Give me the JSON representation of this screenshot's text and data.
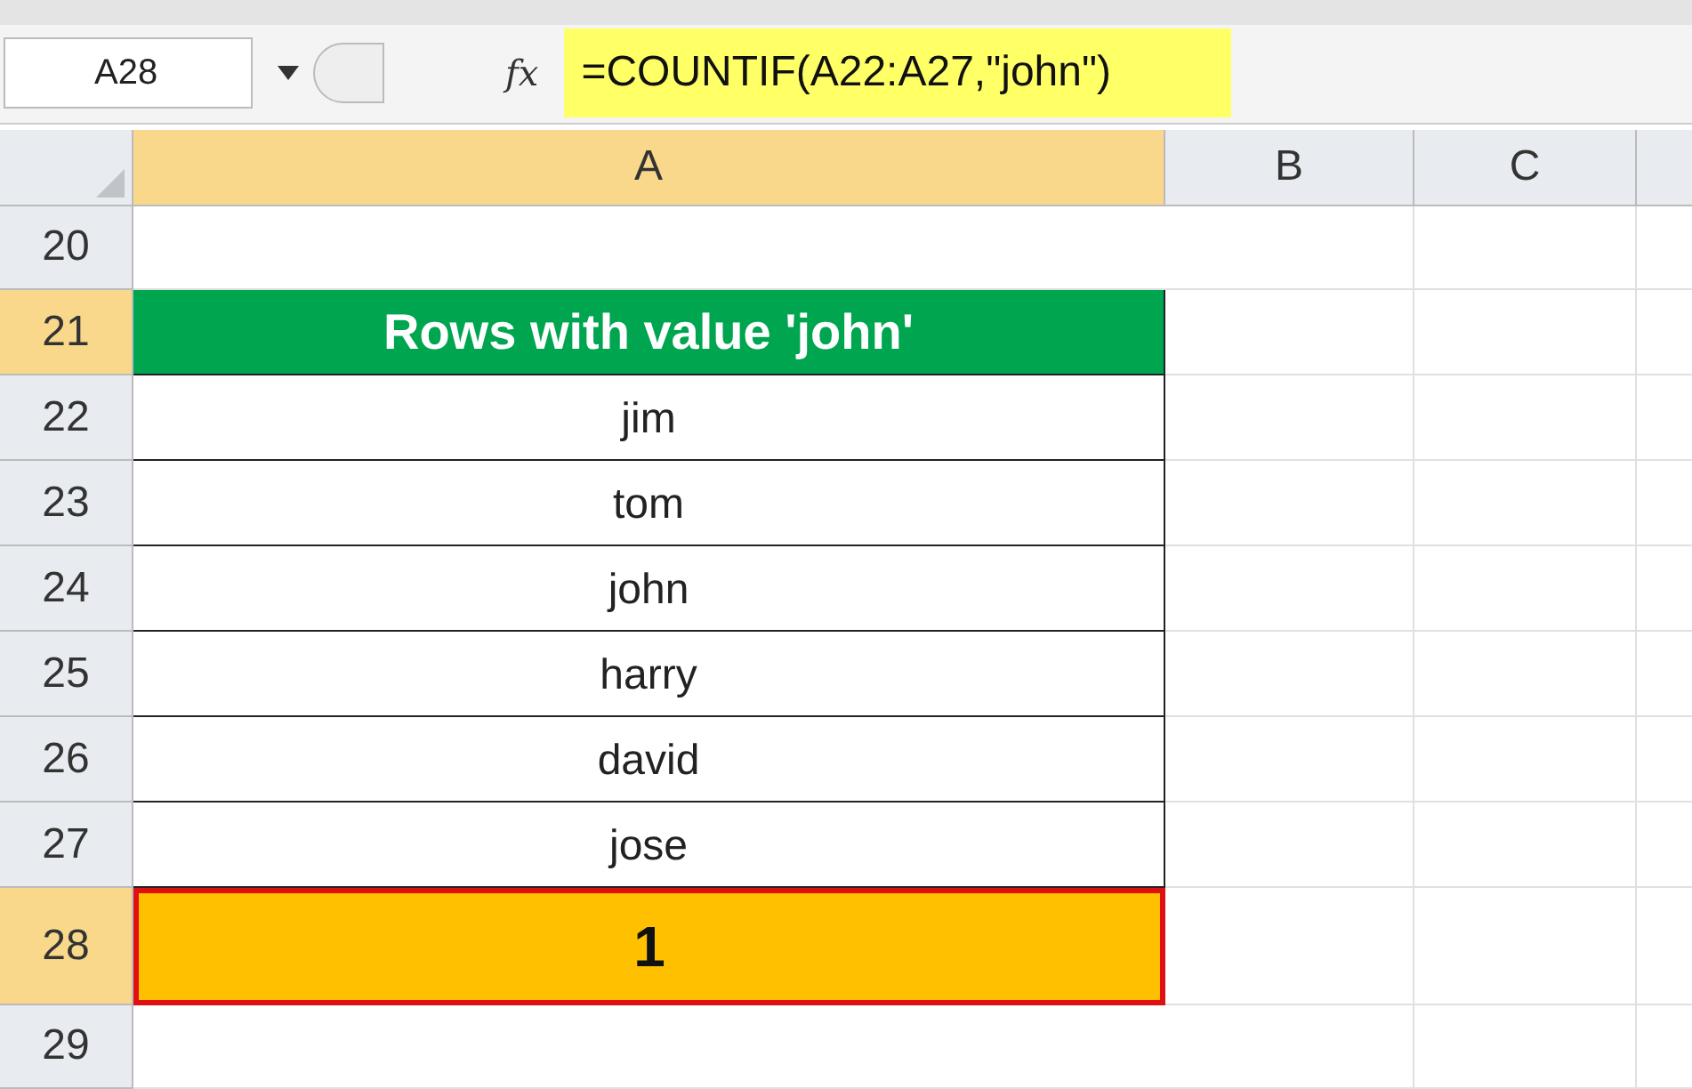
{
  "formula_bar": {
    "name_box": "A28",
    "function_label": "fx",
    "formula": "=COUNTIF(A22:A27,\"john\")",
    "highlighted": true
  },
  "columns": [
    {
      "label": "A",
      "selected": true
    },
    {
      "label": "B",
      "selected": false
    },
    {
      "label": "C",
      "selected": false
    }
  ],
  "rows": [
    {
      "number": "20",
      "selected": false,
      "kind": "blank"
    },
    {
      "number": "21",
      "selected": true,
      "kind": "title",
      "value": "Rows with value 'john'"
    },
    {
      "number": "22",
      "selected": false,
      "kind": "data",
      "value": "jim"
    },
    {
      "number": "23",
      "selected": false,
      "kind": "data",
      "value": "tom"
    },
    {
      "number": "24",
      "selected": false,
      "kind": "data",
      "value": "john"
    },
    {
      "number": "25",
      "selected": false,
      "kind": "data",
      "value": "harry"
    },
    {
      "number": "26",
      "selected": false,
      "kind": "data",
      "value": "david"
    },
    {
      "number": "27",
      "selected": false,
      "kind": "data",
      "value": "jose"
    },
    {
      "number": "28",
      "selected": true,
      "kind": "result",
      "value": "1"
    },
    {
      "number": "29",
      "selected": false,
      "kind": "blank"
    }
  ]
}
